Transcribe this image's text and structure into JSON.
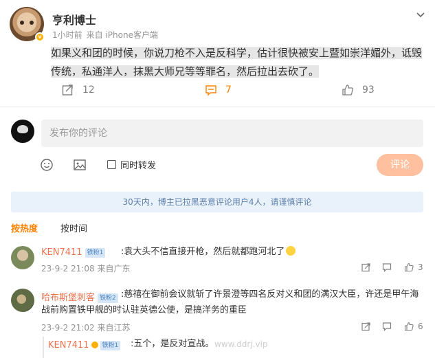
{
  "post": {
    "author": "亨利博士",
    "time": "1小时前",
    "source": "来自 iPhone客户端",
    "text_line1": "如果义和团的时候，你说刀枪不入是反科学，估计很快被安上暨如崇洋媚外，诋毁",
    "text_line2": "传统，私通洋人，抹黑大师兄等等罪名，然后拉出去砍了。",
    "repost_count": "12",
    "comment_count": "7",
    "like_count": "93"
  },
  "composer": {
    "placeholder": "发布你的评论",
    "repost_label": "同时转发",
    "submit_label": "评论"
  },
  "notice": "30天内，博主已拉黑恶意评论用户4人，请谨慎评论",
  "tabs": [
    "按热度",
    "按时间"
  ],
  "comments": [
    {
      "user": "KEN7411",
      "badge": "铁粉1",
      "text": ":袁大头不信直接开枪，然后就都跑河北了",
      "time": "23-9-2 21:08",
      "location": "来自广东",
      "likes": "3"
    },
    {
      "user": "哈布斯堡刺客",
      "badge": "铁粉2",
      "text_line1": ":慈禧在御前会议就斩了许景澄等四名反对义和团的满汉大臣，许还是甲午海",
      "text_line2": "战前购置铁甲舰的时认驻英德公使，是搞洋务的重臣",
      "time": "23-9-2 21:02",
      "location": "来自江苏",
      "likes": "6"
    }
  ],
  "reply": {
    "user": "KEN7411",
    "badge": "铁粉1",
    "text": ":五个，是反对宣战。"
  },
  "watermark": "www.ddrj.vip",
  "colors": {
    "accent": "#ff8200",
    "username": "#eb7350",
    "notice_bg": "#e9f1fb"
  }
}
